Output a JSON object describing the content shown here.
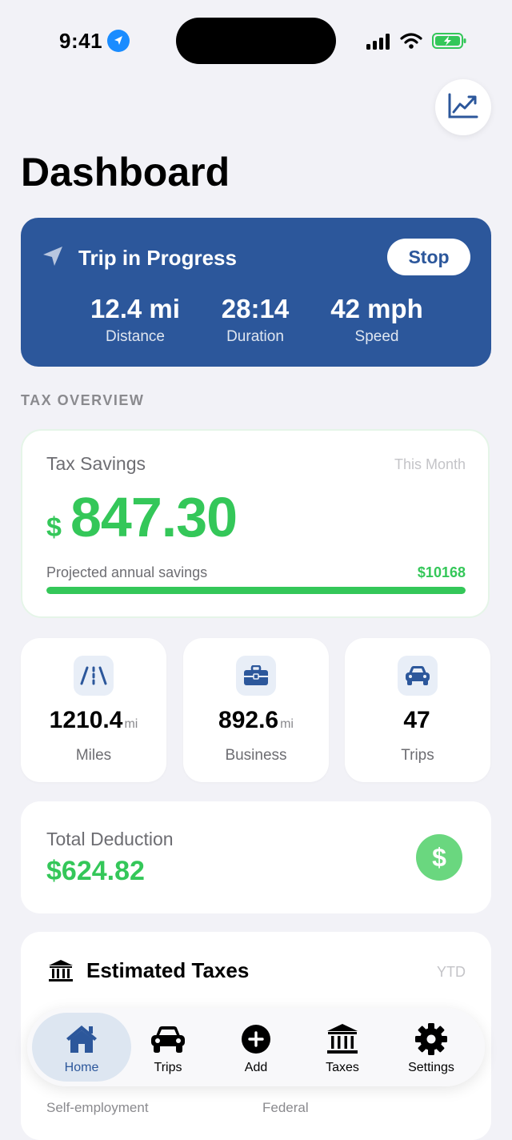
{
  "status_bar": {
    "time": "9:41"
  },
  "page": {
    "title": "Dashboard"
  },
  "trip": {
    "title": "Trip in Progress",
    "stop_label": "Stop",
    "stats": [
      {
        "value": "12.4 mi",
        "label": "Distance"
      },
      {
        "value": "28:14",
        "label": "Duration"
      },
      {
        "value": "42 mph",
        "label": "Speed"
      }
    ]
  },
  "tax_overview": {
    "section_label": "TAX OVERVIEW",
    "savings": {
      "title": "Tax Savings",
      "period": "This Month",
      "currency": "$",
      "amount": "847.30",
      "projected_label": "Projected annual savings",
      "projected_value": "$10168",
      "progress_fraction": 1.0
    }
  },
  "stats": [
    {
      "icon": "road-icon",
      "value": "1210.4",
      "unit": "mi",
      "label": "Miles"
    },
    {
      "icon": "briefcase-icon",
      "value": "892.6",
      "unit": "mi",
      "label": "Business"
    },
    {
      "icon": "car-icon",
      "value": "47",
      "unit": "",
      "label": "Trips"
    }
  ],
  "deduction": {
    "label": "Total Deduction",
    "value": "$624.82",
    "icon": "dollar-icon"
  },
  "estimated_taxes": {
    "title": "Estimated Taxes",
    "period": "YTD",
    "sub_left": "Self-employment",
    "sub_right": "Federal"
  },
  "tab_bar": {
    "tabs": [
      {
        "label": "Home",
        "icon": "house-icon",
        "active": true
      },
      {
        "label": "Trips",
        "icon": "car-icon",
        "active": false
      },
      {
        "label": "Add",
        "icon": "plus-circle-icon",
        "active": false
      },
      {
        "label": "Taxes",
        "icon": "bank-icon",
        "active": false
      },
      {
        "label": "Settings",
        "icon": "gear-icon",
        "active": false
      }
    ]
  },
  "colors": {
    "brand_blue": "#2c579b",
    "success_green": "#34c759",
    "background": "#f2f2f7"
  }
}
